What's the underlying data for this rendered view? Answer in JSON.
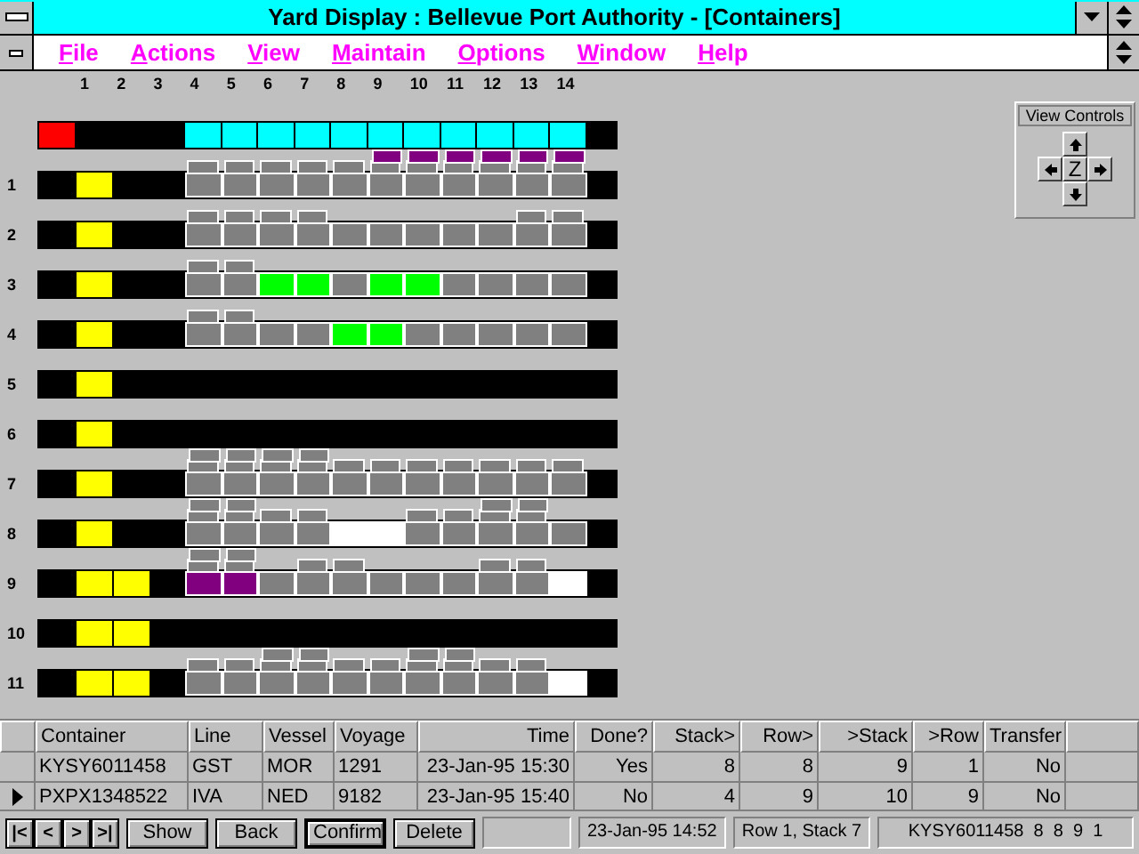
{
  "window": {
    "title": "Yard Display : Bellevue Port Authority - [Containers]"
  },
  "menu": [
    "File",
    "Actions",
    "View",
    "Maintain",
    "Options",
    "Window",
    "Help"
  ],
  "yard": {
    "columns": [
      "1",
      "2",
      "3",
      "4",
      "5",
      "6",
      "7",
      "8",
      "9",
      "10",
      "11",
      "12",
      "13",
      "14"
    ],
    "top_bar": {
      "rail": [
        {
          "kind": "red"
        }
      ],
      "slots": [
        {
          "kind": "cyan"
        },
        {
          "kind": "cyan"
        },
        {
          "kind": "cyan"
        },
        {
          "kind": "cyan"
        },
        {
          "kind": "cyan"
        },
        {
          "kind": "cyan"
        },
        {
          "kind": "cyan"
        },
        {
          "kind": "cyan"
        },
        {
          "kind": "cyan"
        },
        {
          "kind": "cyan"
        },
        {
          "kind": "cyan"
        }
      ]
    },
    "rows": [
      {
        "label": "1",
        "rail": [
          {
            "kind": "empty"
          },
          {
            "kind": "yellow"
          }
        ],
        "slots": [
          {
            "kind": "gray",
            "stack": [
              {
                "kind": "gray"
              }
            ]
          },
          {
            "kind": "gray",
            "stack": [
              {
                "kind": "gray"
              }
            ]
          },
          {
            "kind": "gray",
            "stack": [
              {
                "kind": "gray"
              }
            ]
          },
          {
            "kind": "gray",
            "stack": [
              {
                "kind": "gray"
              }
            ]
          },
          {
            "kind": "gray",
            "stack": [
              {
                "kind": "gray"
              }
            ]
          },
          {
            "kind": "gray",
            "stack": [
              {
                "kind": "gray"
              },
              {
                "kind": "purple"
              }
            ]
          },
          {
            "kind": "gray",
            "stack": [
              {
                "kind": "gray"
              },
              {
                "kind": "purple"
              }
            ]
          },
          {
            "kind": "gray",
            "stack": [
              {
                "kind": "gray"
              },
              {
                "kind": "purple"
              }
            ]
          },
          {
            "kind": "gray",
            "stack": [
              {
                "kind": "gray"
              },
              {
                "kind": "purple"
              }
            ]
          },
          {
            "kind": "gray",
            "stack": [
              {
                "kind": "gray"
              },
              {
                "kind": "purple"
              }
            ]
          },
          {
            "kind": "gray",
            "stack": [
              {
                "kind": "gray"
              },
              {
                "kind": "purple"
              }
            ]
          }
        ]
      },
      {
        "label": "2",
        "rail": [
          {
            "kind": "empty"
          },
          {
            "kind": "yellow"
          }
        ],
        "slots": [
          {
            "kind": "gray",
            "stack": [
              {
                "kind": "gray"
              }
            ]
          },
          {
            "kind": "gray",
            "stack": [
              {
                "kind": "gray"
              }
            ]
          },
          {
            "kind": "gray",
            "stack": [
              {
                "kind": "gray"
              }
            ]
          },
          {
            "kind": "gray",
            "stack": [
              {
                "kind": "gray"
              }
            ]
          },
          {
            "kind": "gray"
          },
          {
            "kind": "gray"
          },
          {
            "kind": "gray"
          },
          {
            "kind": "gray"
          },
          {
            "kind": "gray"
          },
          {
            "kind": "gray",
            "stack": [
              {
                "kind": "gray"
              }
            ]
          },
          {
            "kind": "gray",
            "stack": [
              {
                "kind": "gray"
              }
            ]
          }
        ]
      },
      {
        "label": "3",
        "rail": [
          {
            "kind": "empty"
          },
          {
            "kind": "yellow"
          }
        ],
        "slots": [
          {
            "kind": "gray",
            "stack": [
              {
                "kind": "gray"
              }
            ]
          },
          {
            "kind": "gray",
            "stack": [
              {
                "kind": "gray"
              }
            ]
          },
          {
            "kind": "green"
          },
          {
            "kind": "green"
          },
          {
            "kind": "gray"
          },
          {
            "kind": "green"
          },
          {
            "kind": "green"
          },
          {
            "kind": "gray"
          },
          {
            "kind": "gray"
          },
          {
            "kind": "gray"
          },
          {
            "kind": "gray"
          }
        ]
      },
      {
        "label": "4",
        "rail": [
          {
            "kind": "empty"
          },
          {
            "kind": "yellow"
          }
        ],
        "slots": [
          {
            "kind": "gray",
            "stack": [
              {
                "kind": "gray"
              }
            ]
          },
          {
            "kind": "gray",
            "stack": [
              {
                "kind": "gray"
              }
            ]
          },
          {
            "kind": "gray"
          },
          {
            "kind": "gray"
          },
          {
            "kind": "green"
          },
          {
            "kind": "green"
          },
          {
            "kind": "gray"
          },
          {
            "kind": "gray"
          },
          {
            "kind": "gray"
          },
          {
            "kind": "gray"
          },
          {
            "kind": "gray"
          }
        ]
      },
      {
        "label": "5",
        "rail": [
          {
            "kind": "empty"
          },
          {
            "kind": "yellow"
          }
        ]
      },
      {
        "label": "6",
        "rail": [
          {
            "kind": "empty"
          },
          {
            "kind": "yellow"
          }
        ]
      },
      {
        "label": "7",
        "rail": [
          {
            "kind": "empty"
          },
          {
            "kind": "yellow"
          }
        ],
        "slots": [
          {
            "kind": "gray",
            "stack": [
              {
                "kind": "gray"
              },
              {
                "kind": "gray"
              }
            ]
          },
          {
            "kind": "gray",
            "stack": [
              {
                "kind": "gray"
              },
              {
                "kind": "gray"
              }
            ]
          },
          {
            "kind": "gray",
            "stack": [
              {
                "kind": "gray"
              },
              {
                "kind": "gray"
              }
            ]
          },
          {
            "kind": "gray",
            "stack": [
              {
                "kind": "gray"
              },
              {
                "kind": "gray"
              }
            ]
          },
          {
            "kind": "gray",
            "stack": [
              {
                "kind": "gray"
              }
            ]
          },
          {
            "kind": "gray",
            "stack": [
              {
                "kind": "gray"
              }
            ]
          },
          {
            "kind": "gray",
            "stack": [
              {
                "kind": "gray"
              }
            ]
          },
          {
            "kind": "gray",
            "stack": [
              {
                "kind": "gray"
              }
            ]
          },
          {
            "kind": "gray",
            "stack": [
              {
                "kind": "gray"
              }
            ]
          },
          {
            "kind": "gray",
            "stack": [
              {
                "kind": "gray"
              }
            ]
          },
          {
            "kind": "gray",
            "stack": [
              {
                "kind": "gray"
              }
            ]
          }
        ]
      },
      {
        "label": "8",
        "rail": [
          {
            "kind": "empty"
          },
          {
            "kind": "yellow"
          }
        ],
        "slots": [
          {
            "kind": "gray",
            "stack": [
              {
                "kind": "gray"
              },
              {
                "kind": "gray"
              }
            ]
          },
          {
            "kind": "gray",
            "stack": [
              {
                "kind": "gray"
              },
              {
                "kind": "gray"
              }
            ]
          },
          {
            "kind": "gray",
            "stack": [
              {
                "kind": "gray"
              }
            ]
          },
          {
            "kind": "gray",
            "stack": [
              {
                "kind": "gray"
              }
            ]
          },
          {
            "kind": "white"
          },
          {
            "kind": "white"
          },
          {
            "kind": "gray",
            "stack": [
              {
                "kind": "gray"
              }
            ]
          },
          {
            "kind": "gray",
            "stack": [
              {
                "kind": "gray"
              }
            ]
          },
          {
            "kind": "gray",
            "stack": [
              {
                "kind": "gray"
              },
              {
                "kind": "gray"
              }
            ]
          },
          {
            "kind": "gray",
            "stack": [
              {
                "kind": "gray"
              },
              {
                "kind": "gray"
              }
            ]
          },
          {
            "kind": "gray"
          }
        ]
      },
      {
        "label": "9",
        "rail": [
          {
            "kind": "empty"
          },
          {
            "kind": "yellow"
          },
          {
            "kind": "yellow"
          }
        ],
        "slots": [
          {
            "kind": "purple",
            "stack": [
              {
                "kind": "gray"
              },
              {
                "kind": "gray"
              }
            ]
          },
          {
            "kind": "purple",
            "stack": [
              {
                "kind": "gray"
              },
              {
                "kind": "gray"
              }
            ]
          },
          {
            "kind": "gray"
          },
          {
            "kind": "gray",
            "stack": [
              {
                "kind": "gray"
              }
            ]
          },
          {
            "kind": "gray",
            "stack": [
              {
                "kind": "gray"
              }
            ]
          },
          {
            "kind": "gray"
          },
          {
            "kind": "gray"
          },
          {
            "kind": "gray"
          },
          {
            "kind": "gray",
            "stack": [
              {
                "kind": "gray"
              }
            ]
          },
          {
            "kind": "gray",
            "stack": [
              {
                "kind": "gray"
              }
            ]
          },
          {
            "kind": "white"
          }
        ]
      },
      {
        "label": "10",
        "rail": [
          {
            "kind": "empty"
          },
          {
            "kind": "yellow"
          },
          {
            "kind": "yellow"
          }
        ]
      },
      {
        "label": "11",
        "rail": [
          {
            "kind": "empty"
          },
          {
            "kind": "yellow"
          },
          {
            "kind": "yellow"
          }
        ],
        "slots": [
          {
            "kind": "gray",
            "stack": [
              {
                "kind": "gray"
              }
            ]
          },
          {
            "kind": "gray",
            "stack": [
              {
                "kind": "gray"
              }
            ]
          },
          {
            "kind": "gray",
            "stack": [
              {
                "kind": "gray"
              },
              {
                "kind": "gray"
              }
            ]
          },
          {
            "kind": "gray",
            "stack": [
              {
                "kind": "gray"
              },
              {
                "kind": "gray"
              }
            ]
          },
          {
            "kind": "gray",
            "stack": [
              {
                "kind": "gray"
              }
            ]
          },
          {
            "kind": "gray",
            "stack": [
              {
                "kind": "gray"
              }
            ]
          },
          {
            "kind": "gray",
            "stack": [
              {
                "kind": "gray"
              },
              {
                "kind": "gray"
              }
            ]
          },
          {
            "kind": "gray",
            "stack": [
              {
                "kind": "gray"
              },
              {
                "kind": "gray"
              }
            ]
          },
          {
            "kind": "gray",
            "stack": [
              {
                "kind": "gray"
              }
            ]
          },
          {
            "kind": "gray",
            "stack": [
              {
                "kind": "gray"
              }
            ]
          },
          {
            "kind": "white"
          }
        ]
      }
    ]
  },
  "view_controls": {
    "title": "View Controls",
    "zoom": "Z"
  },
  "table": {
    "columns": [
      "Container",
      "Line",
      "Vessel",
      "Voyage",
      "Time",
      "Done?",
      "Stack>",
      "Row>",
      ">Stack",
      ">Row",
      "Transfer"
    ],
    "rows": [
      {
        "selected": false,
        "cells": [
          "KYSY6011458",
          "GST",
          "MOR",
          "1291",
          "23-Jan-95 15:30",
          "Yes",
          "8",
          "8",
          "9",
          "1",
          "No"
        ]
      },
      {
        "selected": true,
        "cells": [
          "PXPX1348522",
          "IVA",
          "NED",
          "9182",
          "23-Jan-95 15:40",
          "No",
          "4",
          "9",
          "10",
          "9",
          "No"
        ]
      }
    ]
  },
  "nav_buttons": [
    "|<",
    "<",
    ">",
    ">|"
  ],
  "buttons": [
    {
      "label": "Show",
      "default": false
    },
    {
      "label": "Back",
      "default": false
    },
    {
      "label": "Confirm",
      "default": true
    },
    {
      "label": "Delete",
      "default": false
    }
  ],
  "status": [
    "23-Jan-95 14:52",
    "Row 1, Stack 7",
    "KYSY6011458  8  8  9  1"
  ]
}
